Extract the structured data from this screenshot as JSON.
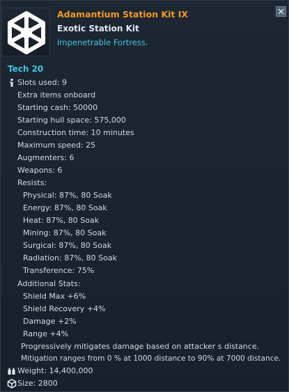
{
  "item": {
    "title": "Adamantium Station Kit IX",
    "subtitle": "Exotic Station Kit",
    "tagline": "Impenetrable Fortress.",
    "icon": "hexagon-spoked-wheel-icon"
  },
  "close_icon": "close-icon",
  "tech": "Tech 20",
  "stats": {
    "slots_used": "Slots used: 9",
    "extra_items": "Extra items onboard",
    "starting_cash": "Starting cash: 50000",
    "starting_hull": "Starting hull space: 575,000",
    "construction_time": "Construction time: 10 minutes",
    "max_speed": "Maximum speed: 25",
    "augmenters": "Augmenters: 6",
    "weapons": "Weapons: 6",
    "resists_header": "Resists:",
    "resists": [
      "Physical: 87%, 80 Soak",
      "Energy: 87%, 80 Soak",
      "Heat: 87%, 80 Soak",
      "Mining: 87%, 80 Soak",
      "Surgical: 87%, 80 Soak",
      "Radiation: 87%, 80 Soak",
      "Transference: 75%"
    ],
    "additional_header": "Additional Stats:",
    "additional": [
      "Shield Max +6%",
      "Shield Recovery +4%",
      "Damage +2%",
      "Range +4%"
    ],
    "mitigation_1": "Progressively mitigates damage based on attacker s distance.",
    "mitigation_2": "Mitigation ranges from 0 % at 1000 distance to 90% at 7000 distance.",
    "weight": "Weight: 14,400,000",
    "size": "Size: 2800"
  },
  "icons": {
    "info": "info-icon",
    "weight": "weight-icon",
    "size": "cube-icon"
  },
  "colors": {
    "title": "#f29a27",
    "tagline": "#3fc7dd",
    "background": "#1b2430"
  }
}
